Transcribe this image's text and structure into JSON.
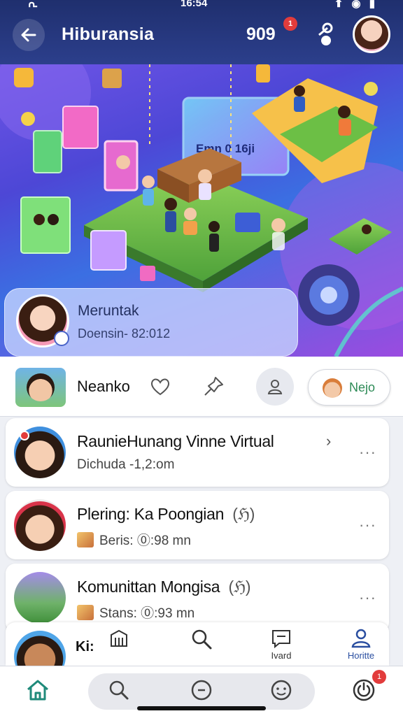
{
  "status_bar": {
    "left": "ᕆ",
    "time": "16:54",
    "right": "⬆ ◉ ▮"
  },
  "header": {
    "title": "Hiburansia",
    "right_text": "909",
    "notification_badge": "1"
  },
  "profile_card": {
    "name": "Meruntak",
    "subtitle": "Doensin- 82:012"
  },
  "action_row": {
    "name": "Neanko",
    "follow_label": "Nejo"
  },
  "list": [
    {
      "title": "RaunieHunang Vinne Virtual",
      "subtitle": "Dichuda -1,2:om",
      "chevron": "›",
      "more": "···"
    },
    {
      "title": "Plering: Ka Poongian",
      "tag": "(ℌ)",
      "subtitle": "Beris: ⓪:98 mn",
      "more": "···"
    },
    {
      "title": "Komunittan Mongisa",
      "tag": "(ℌ)",
      "subtitle": "Stans: ⓪:93 mn",
      "more": "···"
    }
  ],
  "subtabs": {
    "leading_label": "Ki:",
    "items": [
      {
        "label": "",
        "icon": "library-icon"
      },
      {
        "label": "",
        "icon": "search-icon"
      },
      {
        "label": "Ivard",
        "icon": "chat-box-icon"
      },
      {
        "label": "Horitte",
        "icon": "person-icon"
      }
    ]
  },
  "bottom_nav": {
    "badge": "1",
    "items": [
      "home-icon",
      "search-icon",
      "chat-icon",
      "smile-icon",
      "power-icon"
    ]
  },
  "colors": {
    "header_bg": "#2c3f8c",
    "accent": "#2a4ea0",
    "badge_red": "#e23c3c",
    "follow_green": "#2e8b57"
  }
}
